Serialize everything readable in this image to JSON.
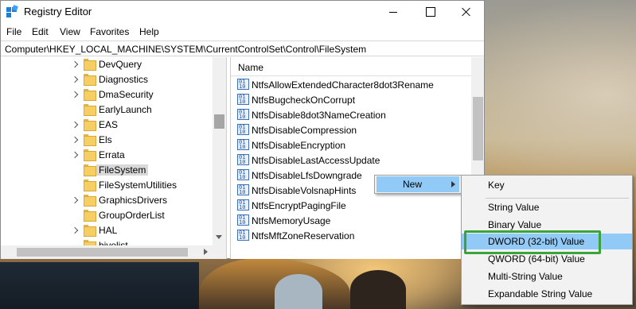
{
  "window": {
    "title": "Registry Editor"
  },
  "menu": {
    "items": [
      "File",
      "Edit",
      "View",
      "Favorites",
      "Help"
    ]
  },
  "address": {
    "path": "Computer\\HKEY_LOCAL_MACHINE\\SYSTEM\\CurrentControlSet\\Control\\FileSystem"
  },
  "tree": {
    "items": [
      {
        "label": "DevQuery",
        "expandable": true
      },
      {
        "label": "Diagnostics",
        "expandable": true
      },
      {
        "label": "DmaSecurity",
        "expandable": true
      },
      {
        "label": "EarlyLaunch",
        "expandable": false
      },
      {
        "label": "EAS",
        "expandable": true
      },
      {
        "label": "Els",
        "expandable": true
      },
      {
        "label": "Errata",
        "expandable": true
      },
      {
        "label": "FileSystem",
        "expandable": false,
        "selected": true
      },
      {
        "label": "FileSystemUtilities",
        "expandable": false
      },
      {
        "label": "GraphicsDrivers",
        "expandable": true
      },
      {
        "label": "GroupOrderList",
        "expandable": false
      },
      {
        "label": "HAL",
        "expandable": true
      },
      {
        "label": "hivelist",
        "expandable": false
      }
    ]
  },
  "values": {
    "column_name": "Name",
    "icon": "registry-value-icon",
    "items": [
      "NtfsAllowExtendedCharacter8dot3Rename",
      "NtfsBugcheckOnCorrupt",
      "NtfsDisable8dot3NameCreation",
      "NtfsDisableCompression",
      "NtfsDisableEncryption",
      "NtfsDisableLastAccessUpdate",
      "NtfsDisableLfsDowngrade",
      "NtfsDisableVolsnapHints",
      "NtfsEncryptPagingFile",
      "NtfsMemoryUsage",
      "NtfsMftZoneReservation"
    ]
  },
  "context_menu": {
    "new_label": "New",
    "submenu": [
      "Key",
      "String Value",
      "Binary Value",
      "DWORD (32-bit) Value",
      "QWORD (64-bit) Value",
      "Multi-String Value",
      "Expandable String Value"
    ],
    "highlighted": "DWORD (32-bit) Value"
  },
  "colors": {
    "menu_highlight": "#91c9f7",
    "annotation_box": "#3aa33a",
    "folder": "#f5cf63"
  }
}
